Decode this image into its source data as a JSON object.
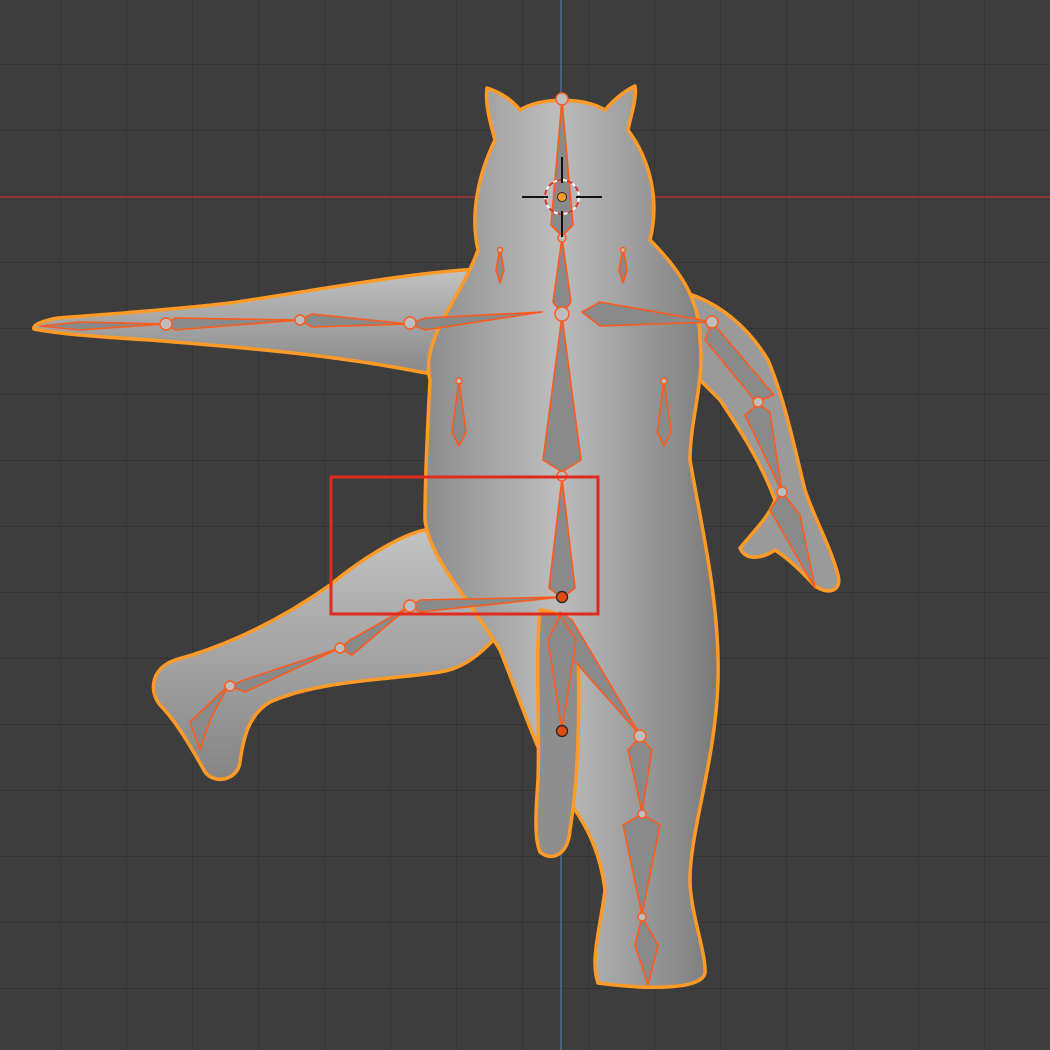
{
  "viewport": {
    "title": "",
    "background": "#3d3d3d",
    "grid_color": "#303030",
    "x_axis_color": "#b0343a",
    "y_axis_color": "#4c6f93"
  },
  "scene": {
    "mesh_color": "#9e9e9e",
    "selection_outline_color": "#ff9a26",
    "bone_outline_color": "#ff5a1a",
    "bone_fill_color": "#8a8a8a",
    "active_joint_color": "#e04a10",
    "cursor": {
      "name": "3d-cursor"
    }
  },
  "annotation": {
    "box_color": "#e02a1e",
    "label": ""
  }
}
